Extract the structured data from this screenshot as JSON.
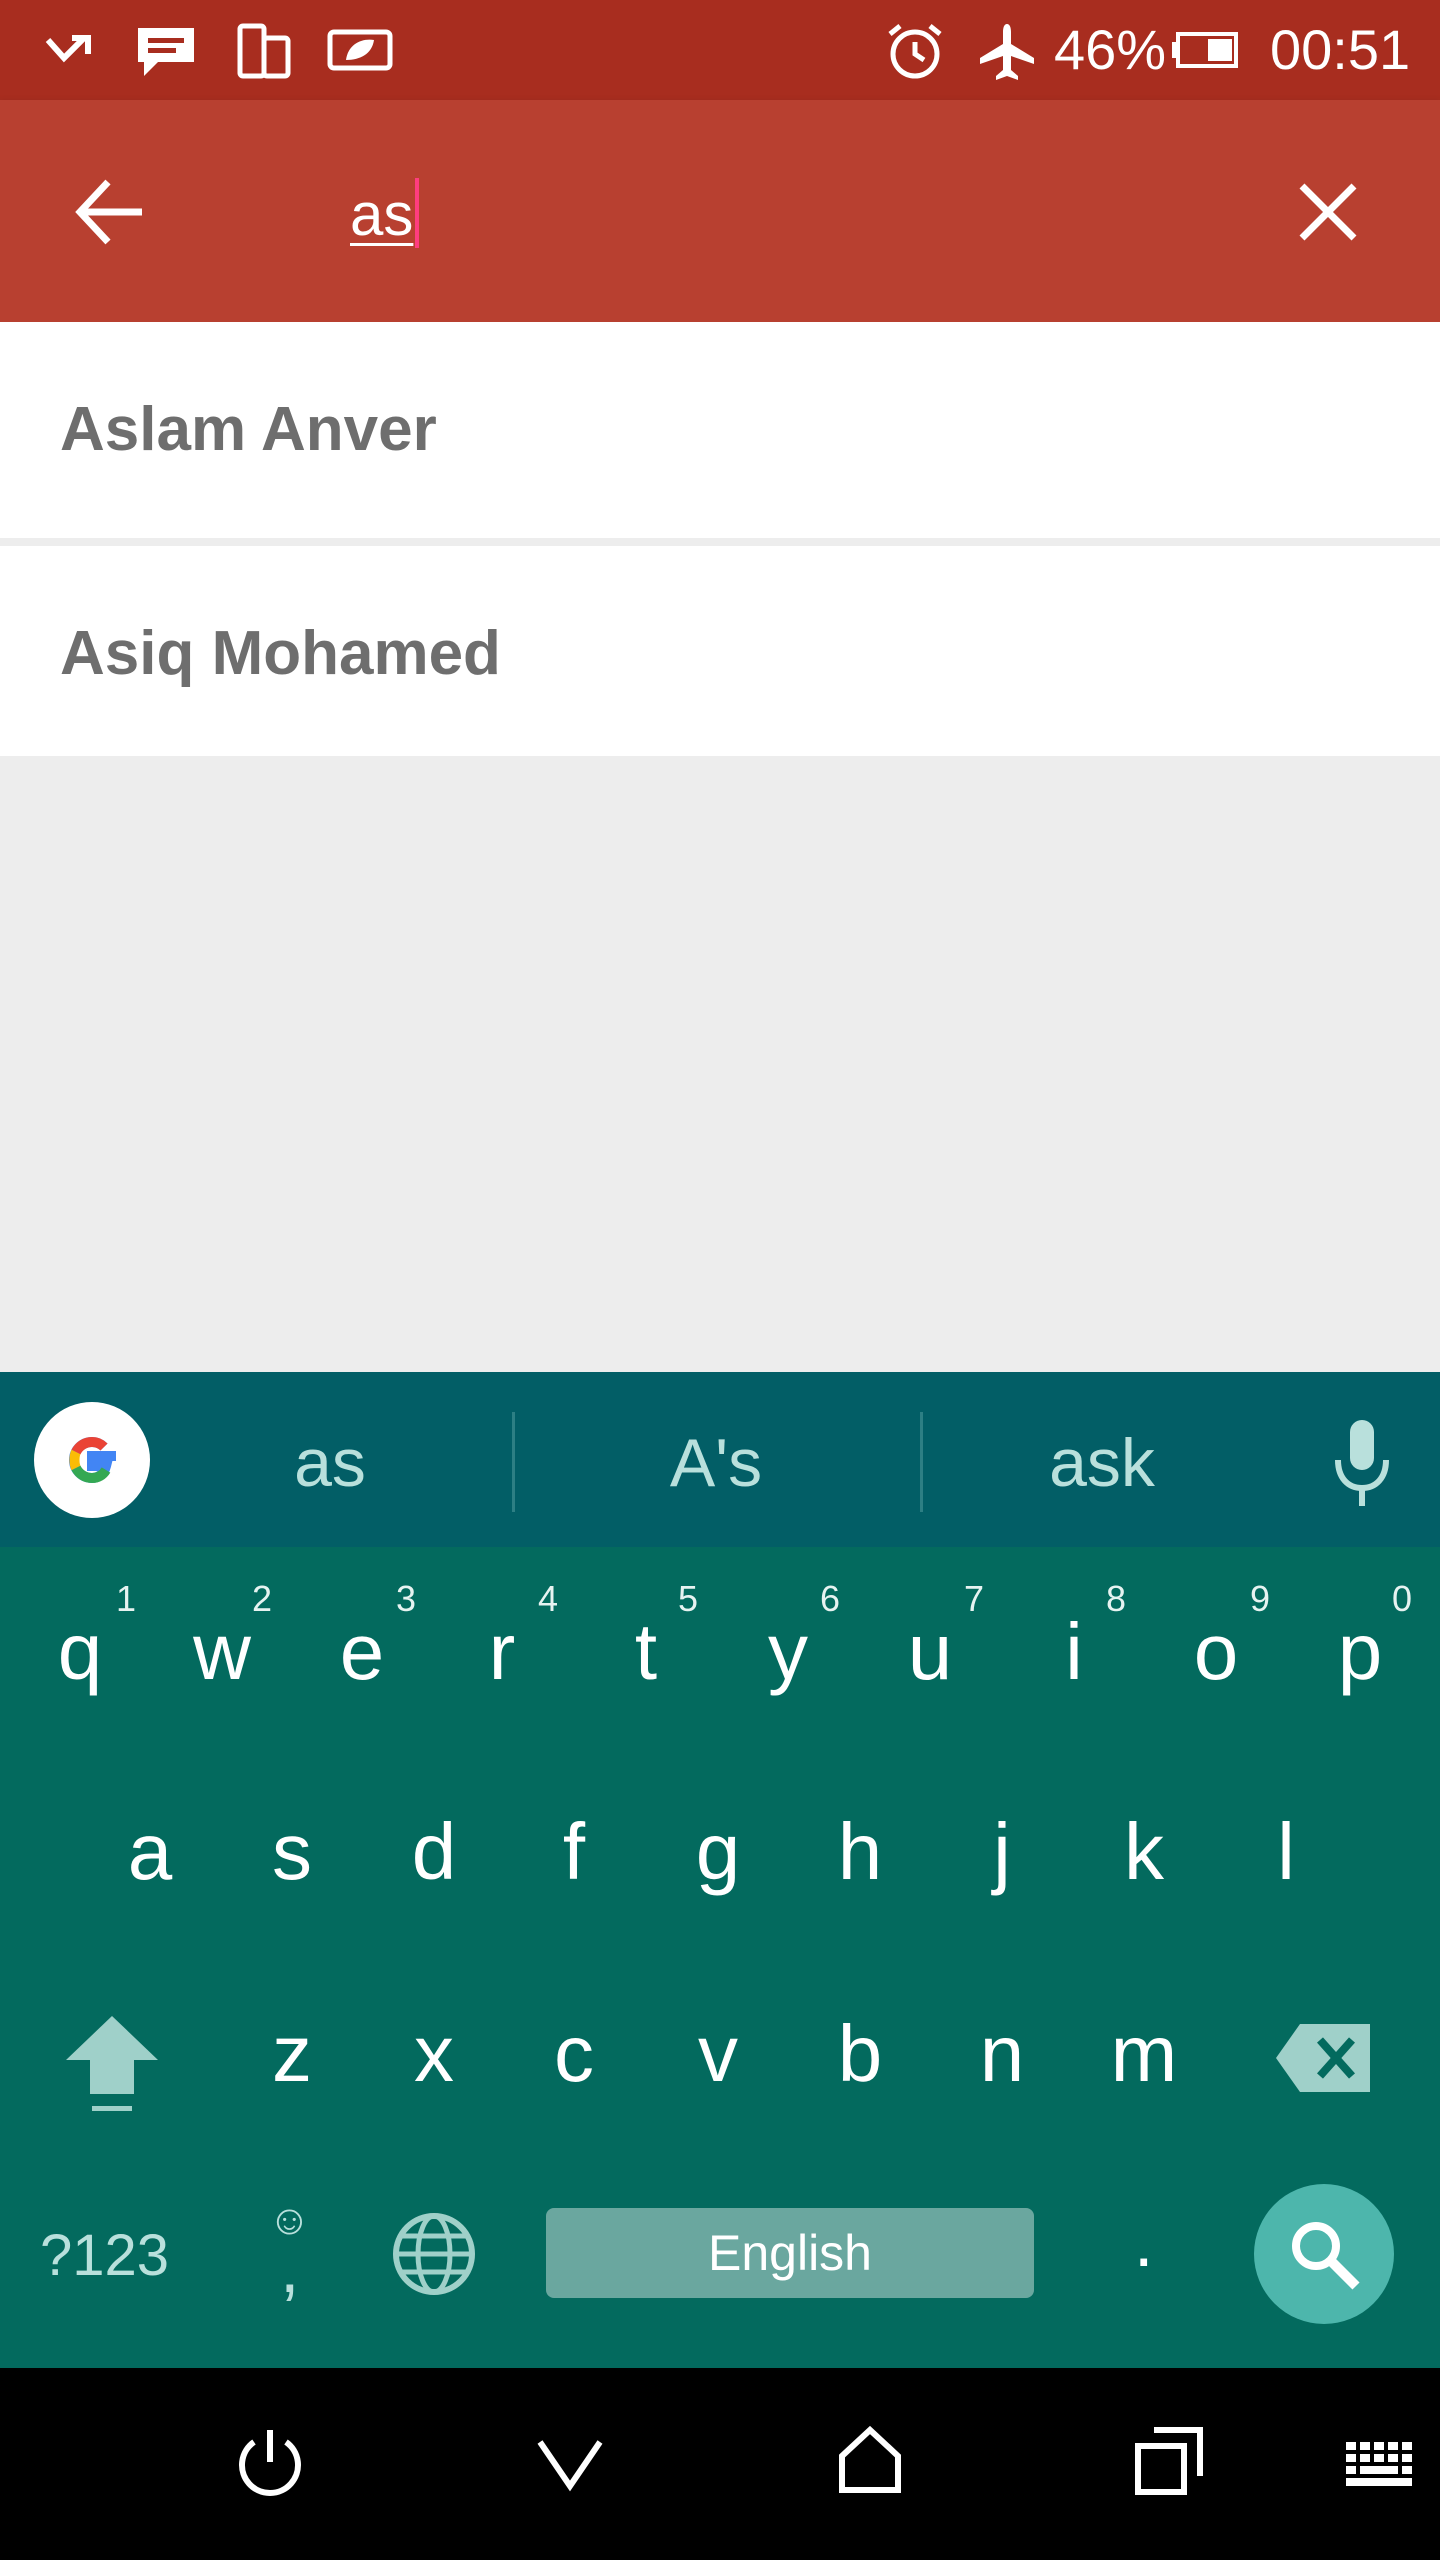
{
  "status_bar": {
    "battery_percent": "46%",
    "time": "00:51"
  },
  "search": {
    "query": "as"
  },
  "results": [
    {
      "name": "Aslam Anver"
    },
    {
      "name": "Asiq Mohamed"
    }
  ],
  "keyboard": {
    "suggestions": [
      "as",
      "A's",
      "ask"
    ],
    "row1": [
      "q",
      "w",
      "e",
      "r",
      "t",
      "y",
      "u",
      "i",
      "o",
      "p"
    ],
    "row1_hints": [
      "1",
      "2",
      "3",
      "4",
      "5",
      "6",
      "7",
      "8",
      "9",
      "0"
    ],
    "row2": [
      "a",
      "s",
      "d",
      "f",
      "g",
      "h",
      "j",
      "k",
      "l"
    ],
    "row3": [
      "z",
      "x",
      "c",
      "v",
      "b",
      "n",
      "m"
    ],
    "symbols_label": "?123",
    "comma_label": ",",
    "space_label": "English",
    "period_label": "."
  },
  "colors": {
    "status_bar": "#a82d1f",
    "toolbar": "#b84030",
    "keyboard": "#036a5e",
    "suggestion_bar": "#025e66",
    "search_fab": "#4db6ac"
  }
}
